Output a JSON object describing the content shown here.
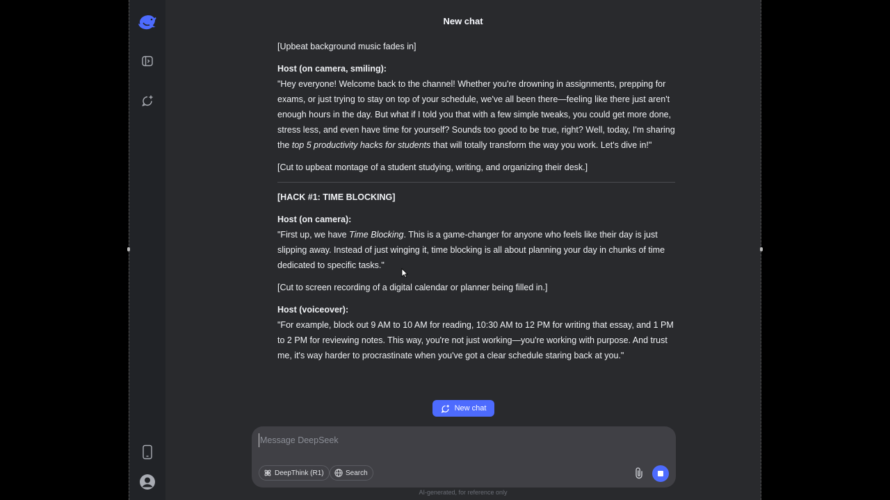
{
  "header": {
    "title": "New chat"
  },
  "sidebar": {
    "items": [
      {
        "icon": "deepseek-logo-icon"
      },
      {
        "icon": "sidebar-toggle-icon"
      },
      {
        "icon": "new-chat-icon"
      },
      {
        "icon": "mobile-app-icon"
      },
      {
        "icon": "user-avatar-icon"
      }
    ]
  },
  "message": {
    "p1": "[Upbeat background music fades in]",
    "host1_label": "Host (on camera, smiling):",
    "host1_pre": "\"Hey everyone! Welcome back to the channel! Whether you're drowning in assignments, prepping for exams, or just trying to stay on top of your schedule, we've all been there—feeling like there just aren't enough hours in the day. But what if I told you that with a few simple tweaks, you could get more done, stress less, and even have time for yourself? Sounds too good to be true, right? Well, today, I'm sharing the ",
    "host1_em": "top 5 productivity hacks for students",
    "host1_post": " that will totally transform the way you work. Let's dive in!\"",
    "p2": "[Cut to upbeat montage of a student studying, writing, and organizing their desk.]",
    "hack_heading": "[HACK #1: TIME BLOCKING]",
    "host2_label": "Host (on camera):",
    "host2_pre": "\"First up, we have ",
    "host2_em": "Time Blocking",
    "host2_post": ". This is a game-changer for anyone who feels like their day is just slipping away. Instead of just winging it, time blocking is all about planning your day in chunks of time dedicated to specific tasks.\"",
    "p3": "[Cut to screen recording of a digital calendar or planner being filled in.]",
    "host3_label": "Host (voiceover):",
    "host3_text": "\"For example, block out 9 AM to 10 AM for reading, 10:30 AM to 12 PM for writing that essay, and 1 PM to 2 PM for reviewing notes. This way, you're not just working—you're working with purpose. And trust me, it's way harder to procrastinate when you've got a clear schedule staring back at you.\""
  },
  "new_chat_button": {
    "label": "New chat"
  },
  "composer": {
    "placeholder": "Message DeepSeek",
    "value": "",
    "deepthink_label": "DeepThink (R1)",
    "search_label": "Search"
  },
  "footnote": "AI-generated, for reference only",
  "colors": {
    "accent": "#4d6bfe",
    "background": "#292a2d",
    "sidebar": "#212327"
  }
}
